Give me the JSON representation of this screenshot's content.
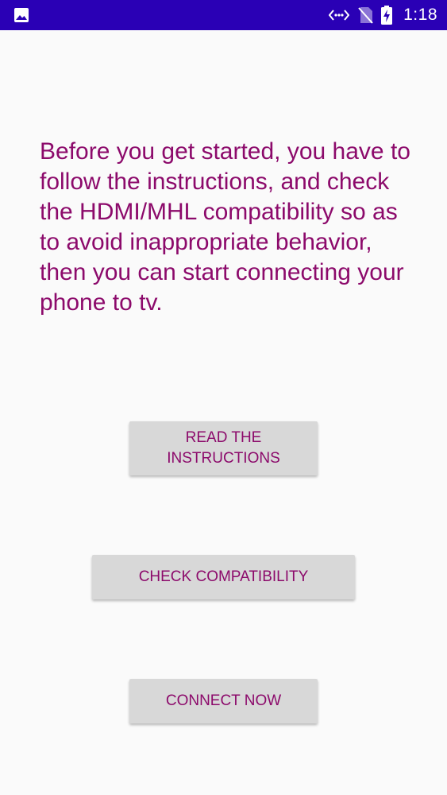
{
  "status_bar": {
    "time": "1:18",
    "background_color": "#2a00b5",
    "icons": [
      "image-icon",
      "data-transfer-icon",
      "no-signal-icon",
      "battery-charging-icon"
    ]
  },
  "main": {
    "intro_text": "Before you get started, you have to follow the instructions, and check the HDMI/MHL compatibility so as to avoid inappropriate behavior, then you can start connecting your phone to tv.",
    "text_color": "#8c0a6b",
    "buttons": {
      "read_instructions_line1": "READ THE",
      "read_instructions_line2": "INSTRUCTIONS",
      "check_compatibility": "CHECK COMPATIBILITY",
      "connect_now": "CONNECT NOW"
    }
  }
}
